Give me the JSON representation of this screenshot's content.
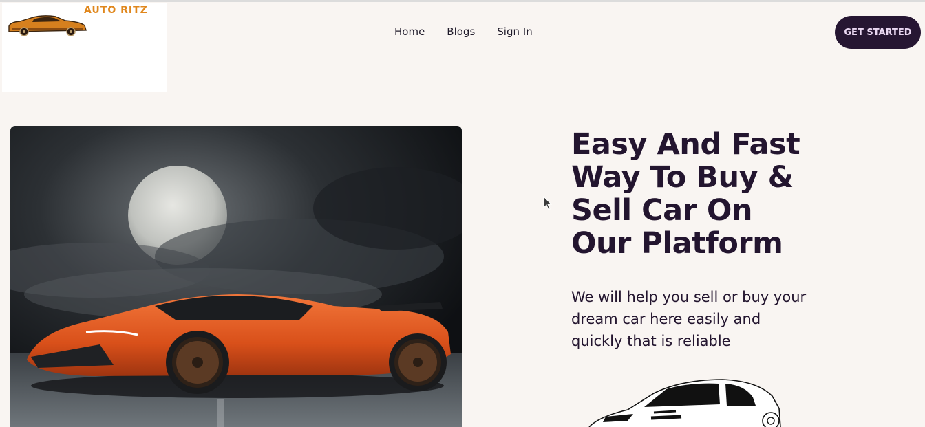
{
  "brand": {
    "name": "AUTO RITZ",
    "logo_icon": "classic-car-icon"
  },
  "nav": {
    "items": [
      {
        "label": "Home"
      },
      {
        "label": "Blogs"
      },
      {
        "label": "Sign In"
      }
    ]
  },
  "cta": {
    "label": "GET STARTED"
  },
  "hero": {
    "title": "Easy And Fast Way To Buy & Sell Car On Our Platform",
    "subtitle": "We will help you sell or buy your dream car here easily and quickly that is reliable",
    "image_icon": "sports-car-photo",
    "sketch_icon": "car-line-sketch"
  },
  "colors": {
    "background": "#f9f5f2",
    "primary_dark": "#261632",
    "heading": "#23152f",
    "logo_accent": "#e0871c",
    "car_orange": "#e4581f"
  }
}
